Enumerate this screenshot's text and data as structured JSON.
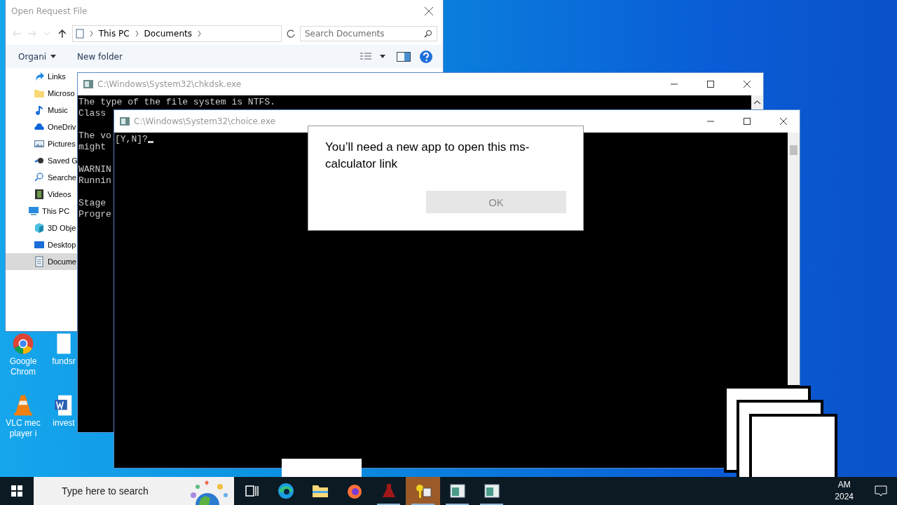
{
  "explorer": {
    "title": "Open Request File",
    "path": [
      "This PC",
      "Documents"
    ],
    "search": {
      "placeholder": "Search Documents"
    },
    "toolbar": {
      "organize": "Organi",
      "new_folder": "New folder"
    },
    "nav": [
      {
        "label": "Links",
        "kind": "link",
        "selected": false
      },
      {
        "label": "Microso",
        "kind": "folder",
        "selected": false
      },
      {
        "label": "Music",
        "kind": "music",
        "selected": false
      },
      {
        "label": "OneDriv",
        "kind": "cloud",
        "selected": false
      },
      {
        "label": "Pictures",
        "kind": "pictures",
        "selected": false
      },
      {
        "label": "Saved G",
        "kind": "games",
        "selected": false
      },
      {
        "label": "Searche",
        "kind": "search",
        "selected": false
      },
      {
        "label": "Videos",
        "kind": "videos",
        "selected": false
      },
      {
        "label": "This PC",
        "kind": "pc",
        "selected": false,
        "children": [
          {
            "label": "3D Obje",
            "kind": "cube",
            "selected": false
          },
          {
            "label": "Desktop",
            "kind": "desktop",
            "selected": false
          },
          {
            "label": "Docume",
            "kind": "document",
            "selected": true
          }
        ]
      }
    ]
  },
  "consoles": [
    {
      "title": "C:\\Windows\\System32\\chkdsk.exe",
      "blocks": [
        [
          "The type of the file system is NTFS.",
          "Class"
        ],
        [
          "The vo",
          "might"
        ],
        [
          "WARNIN",
          "Runnin"
        ],
        [
          "Stage",
          "Progre"
        ]
      ],
      "cursor": false
    },
    {
      "title": "C:\\Windows\\System32\\choice.exe",
      "blocks": [
        [
          "[Y,N]?"
        ]
      ],
      "cursor": true
    }
  ],
  "dialog": {
    "message": "You’ll need a new app to open this ms-calculator link",
    "button": "OK"
  },
  "desktop_icons": [
    {
      "label": "Google Chrom",
      "kind": "chrome"
    },
    {
      "label": "fundsr",
      "kind": "file"
    },
    {
      "label": "VLC mec player i",
      "kind": "vlc"
    },
    {
      "label": "invest",
      "kind": "word"
    }
  ],
  "taskbar": {
    "search": {
      "placeholder": "Type here to search"
    },
    "apps": [
      {
        "kind": "taskview",
        "running": false,
        "active": false
      },
      {
        "kind": "edge",
        "running": false,
        "active": false
      },
      {
        "kind": "explorer",
        "running": false,
        "active": false
      },
      {
        "kind": "firefox",
        "running": false,
        "active": false
      },
      {
        "kind": "flask",
        "running": true,
        "active": false
      },
      {
        "kind": "keys",
        "running": true,
        "active": true
      },
      {
        "kind": "window",
        "running": true,
        "active": false
      },
      {
        "kind": "window",
        "running": true,
        "active": false
      }
    ],
    "clock": [
      "AM",
      "2024"
    ]
  }
}
